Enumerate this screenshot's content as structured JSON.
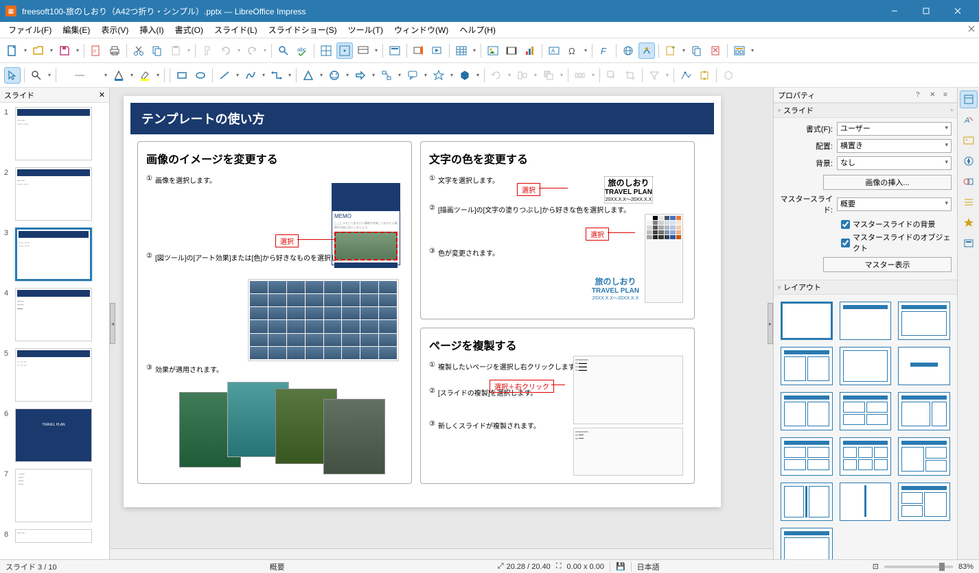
{
  "titlebar": {
    "title": "freesoft100-旅のしおり（A42つ折り・シンプル）.pptx — LibreOffice Impress"
  },
  "menu": {
    "file": "ファイル(F)",
    "edit": "編集(E)",
    "view": "表示(V)",
    "insert": "挿入(I)",
    "format": "書式(O)",
    "slide": "スライド(L)",
    "slideshow": "スライドショー(S)",
    "tools": "ツール(T)",
    "window": "ウィンドウ(W)",
    "help": "ヘルプ(H)"
  },
  "panels": {
    "slides": "スライド",
    "properties": "プロパティ",
    "slide_section": "スライド",
    "layout_section": "レイアウト"
  },
  "props": {
    "format_lbl": "書式(F):",
    "format_val": "ユーザー",
    "orient_lbl": "配置:",
    "orient_val": "横置き",
    "bg_lbl": "背景:",
    "bg_val": "なし",
    "insert_img": "画像の挿入...",
    "master_lbl": "マスタースライド:",
    "master_val": "概要",
    "master_bg": "マスタースライドの背景",
    "master_obj": "マスタースライドのオブジェクト",
    "master_view": "マスター表示"
  },
  "slide_content": {
    "title": "テンプレートの使い方",
    "sec1_title": "画像のイメージを変更する",
    "sec1_s1": "画像を選択します。",
    "sec1_s2": "[図ツール]の[アート効果]または[色]から好きなものを選択します。",
    "sec1_s3": "効果が適用されます。",
    "sec2_title": "文字の色を変更する",
    "sec2_s1": "文字を選択します。",
    "sec2_s2": "[描画ツール]の[文字の塗りつぶし]から好きな色を選択します。",
    "sec2_s3": "色が変更されます。",
    "sec3_title": "ページを複製する",
    "sec3_s1": "複製したいページを選択し右クリックします。",
    "sec3_s2": "[スライドの複製]を選択します。",
    "sec3_s3": "新しくスライドが複製されます。",
    "select_tag": "選択",
    "select_right": "選択＋右クリック",
    "memo": "MEMO",
    "travel1": "旅のしおり",
    "travel2": "TRAVEL PLAN",
    "travel3": "20XX.X.X～20XX.X.X"
  },
  "status": {
    "slide_pos": "スライド 3 / 10",
    "master": "概要",
    "coord": "20.28 / 20.40",
    "size": "0.00 x 0.00",
    "lang": "日本語",
    "zoom": "83%"
  },
  "slide_numbers": [
    "1",
    "2",
    "3",
    "4",
    "5",
    "6",
    "7",
    "8"
  ],
  "step_labels": {
    "n1": "①",
    "n2": "②",
    "n3": "③"
  },
  "icons": {
    "cursor_size": "⤢"
  }
}
